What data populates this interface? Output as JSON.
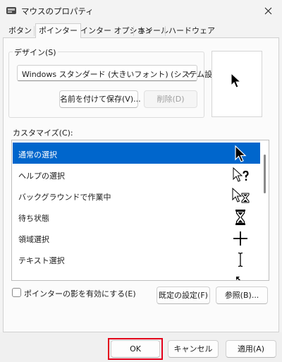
{
  "window": {
    "title": "マウスのプロパティ",
    "app_icon": "mouse-icon",
    "close_icon": "close-icon"
  },
  "tabs": [
    {
      "label": "ボタン",
      "active": false
    },
    {
      "label": "ポインター",
      "active": true
    },
    {
      "label": "ポインター オプション",
      "active": false
    },
    {
      "label": "ホイール",
      "active": false
    },
    {
      "label": "ハードウェア",
      "active": false
    }
  ],
  "scheme": {
    "group_label": "デザイン(S)",
    "selected": "Windows スタンダード (大きいフォント) (システム設定)",
    "save_as_label": "名前を付けて保存(V)...",
    "delete_label": "削除(D)"
  },
  "customize": {
    "label": "カスタマイズ(C):",
    "items": [
      {
        "label": "通常の選択",
        "icon": "arrow-cursor-icon",
        "selected": true
      },
      {
        "label": "ヘルプの選択",
        "icon": "help-cursor-icon",
        "selected": false
      },
      {
        "label": "バックグラウンドで作業中",
        "icon": "working-background-cursor-icon",
        "selected": false
      },
      {
        "label": "待ち状態",
        "icon": "hourglass-cursor-icon",
        "selected": false
      },
      {
        "label": "領域選択",
        "icon": "crosshair-cursor-icon",
        "selected": false
      },
      {
        "label": "テキスト選択",
        "icon": "text-beam-cursor-icon",
        "selected": false
      }
    ]
  },
  "shadow": {
    "label": "ポインターの影を有効にする(E)",
    "checked": false
  },
  "buttons": {
    "default_label": "既定の設定(F)",
    "browse_label": "参照(B)..."
  },
  "footer": {
    "ok_label": "OK",
    "cancel_label": "キャンセル",
    "apply_label": "適用(A)",
    "highlight_color": "#e3001b"
  },
  "colors": {
    "selection": "#0066cc"
  }
}
